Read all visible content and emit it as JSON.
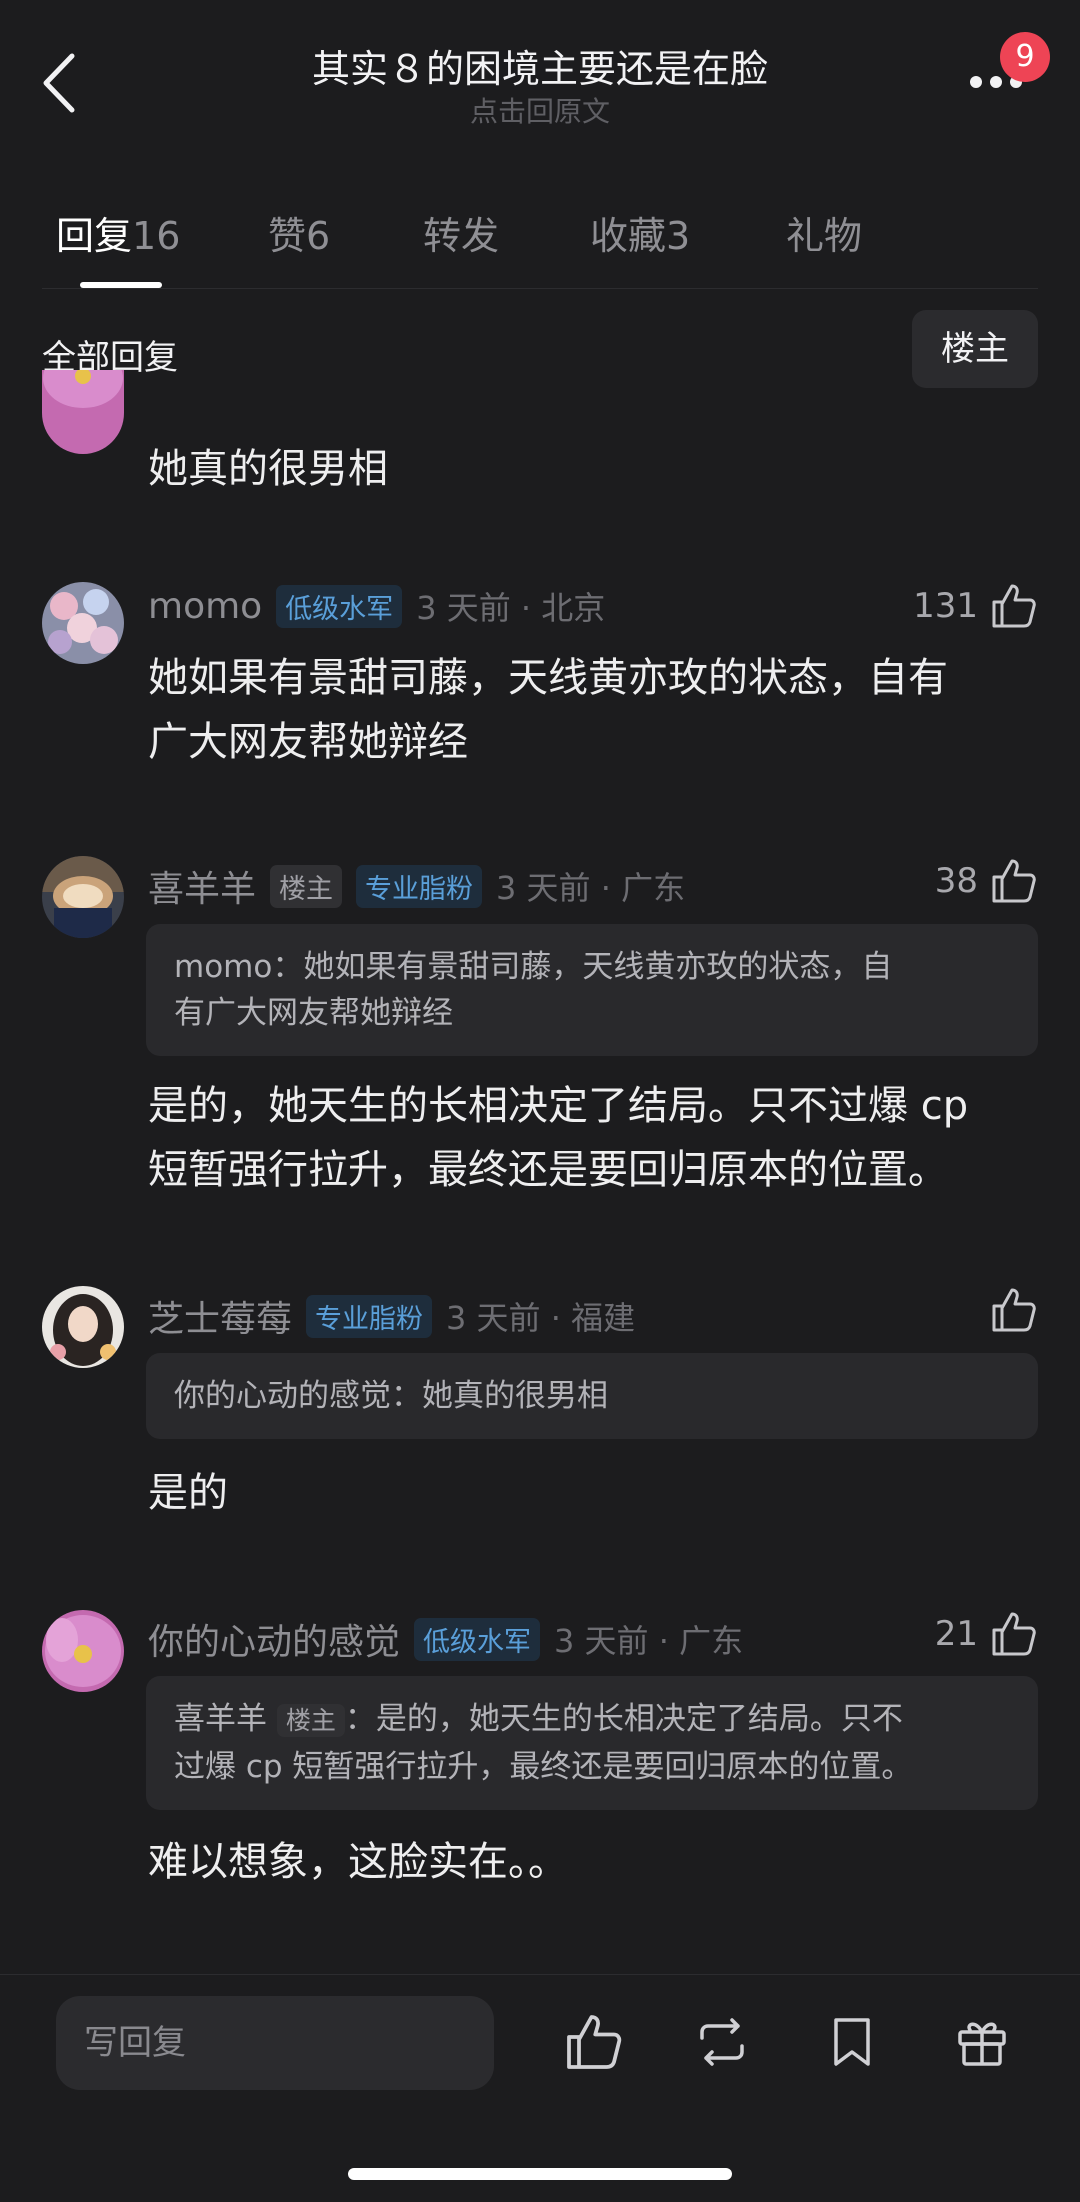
{
  "header": {
    "title": "其实８的困境主要还是在脸",
    "subtitle": "点击回原文",
    "badge": "9"
  },
  "tabs": [
    {
      "label": "回复",
      "count": "16"
    },
    {
      "label": "赞",
      "count": "6"
    },
    {
      "label": "转发",
      "count": ""
    },
    {
      "label": "收藏",
      "count": "3"
    },
    {
      "label": "礼物",
      "count": ""
    }
  ],
  "section": {
    "title": "全部回复",
    "filter": "楼主"
  },
  "comments": [
    {
      "content": "她真的很男相"
    },
    {
      "name": "momo",
      "tags": [
        "低级水军"
      ],
      "meta": "3 天前 · 北京",
      "likes": "131",
      "content_lines": [
        "她如果有景甜司藤，天线黄亦玫的状态，自有",
        "广大网友帮她辩经"
      ]
    },
    {
      "name": "喜羊羊",
      "tags": [
        "楼主",
        "专业脂粉"
      ],
      "meta": "3 天前 · 广东",
      "likes": "38",
      "quote_lines": [
        "momo：她如果有景甜司藤，天线黄亦玫的状态，自",
        "有广大网友帮她辩经"
      ],
      "content_lines": [
        "是的，她天生的长相决定了结局。只不过爆 cp",
        "短暂强行拉升，最终还是要回归原本的位置。"
      ]
    },
    {
      "name": "芝士莓莓",
      "tags": [
        "专业脂粉"
      ],
      "meta": "3 天前 · 福建",
      "likes": "",
      "quote_lines": [
        "你的心动的感觉：她真的很男相"
      ],
      "content_lines": [
        "是的"
      ]
    },
    {
      "name": "你的心动的感觉",
      "tags": [
        "低级水军"
      ],
      "meta": "3 天前 · 广东",
      "likes": "21",
      "quote_author": "喜羊羊",
      "quote_tag": "楼主",
      "quote_lines": [
        "：是的，她天生的长相决定了结局。只不",
        "过爆 cp 短暂强行拉升，最终还是要回归原本的位置。"
      ],
      "content_lines": [
        "难以想象，这脸实在。。"
      ]
    }
  ],
  "bottom": {
    "input_placeholder": "写回复"
  },
  "colors": {
    "background": "#1c1c1e",
    "badge": "#ee4455",
    "tag_blue": "#5a9fd9"
  },
  "icons": [
    "back-icon",
    "more-icon",
    "thumb-up-icon",
    "repost-icon",
    "bookmark-icon",
    "gift-icon"
  ]
}
